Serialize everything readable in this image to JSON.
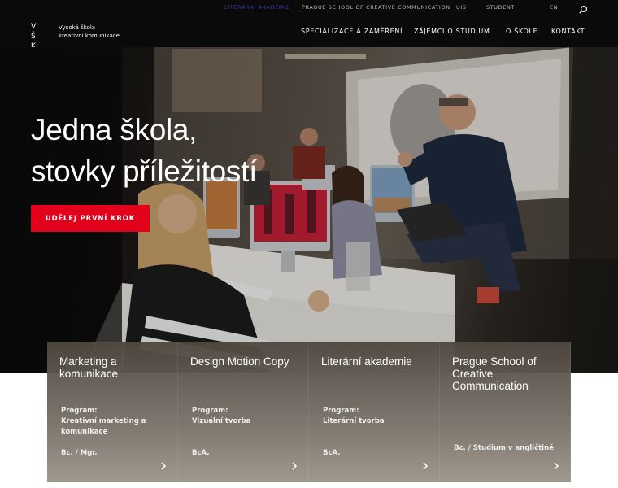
{
  "topbar": {
    "links": [
      {
        "label": "Literární akademie",
        "active": true
      },
      {
        "label": "Prague School of Creative Communication",
        "active": false
      },
      {
        "label": "UIS",
        "active": false
      },
      {
        "label": "Student",
        "active": false
      },
      {
        "label": "EN",
        "active": false
      }
    ],
    "search_icon": "search-icon"
  },
  "logo": {
    "mark_line1": "V Š",
    "mark_line2": "K K",
    "text_line1": "Vysoká škola",
    "text_line2": "kreativní komunikace"
  },
  "nav": {
    "items": [
      "Specializace a zaměření",
      "Zájemci o studium",
      "O škole",
      "Kontakt"
    ]
  },
  "hero": {
    "title_line1": "Jedna škola,",
    "title_line2": "stovky příležitostí",
    "cta_label": "Udělej první krok"
  },
  "cards": [
    {
      "title": "Marketing a komunikace",
      "program_label": "Program:",
      "program": "Kreativní marketing a komunikace",
      "degree": "Bc. / Mgr.",
      "arrow_icon": "chevron-right-icon"
    },
    {
      "title": "Design Motion Copy",
      "program_label": "Program:",
      "program": "Vizuální tvorba",
      "degree": "BcA.",
      "arrow_icon": "chevron-right-icon"
    },
    {
      "title": "Literární akademie",
      "program_label": "Program:",
      "program": "Literární tvorba",
      "degree": "BcA.",
      "arrow_icon": "chevron-right-icon"
    },
    {
      "title": "Prague School of Creative Communication",
      "program_label": "",
      "program": "",
      "degree": "Bc. / Studium v angličtině",
      "arrow_icon": "chevron-right-icon"
    }
  ],
  "colors": {
    "accent_red": "#e2001a",
    "header_bg": "#0a0a0a",
    "active_link": "#3a3aa8"
  }
}
